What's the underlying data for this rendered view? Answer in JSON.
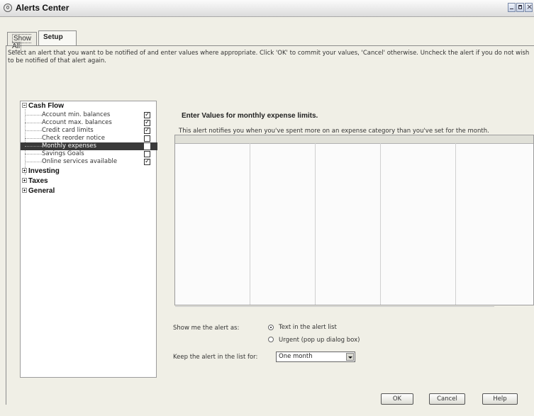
{
  "window": {
    "title": "Alerts Center"
  },
  "tabs": [
    {
      "label": "Show All"
    },
    {
      "label": "Setup"
    }
  ],
  "instructions": "Select an alert that you want to be notified of and enter values where appropriate. Click 'OK' to commit your values, 'Cancel' otherwise. Uncheck the alert if you do not wish to be notified of that alert again.",
  "tree": {
    "groups": [
      {
        "label": "Cash Flow",
        "expanded": true
      },
      {
        "label": "Investing",
        "expanded": false
      },
      {
        "label": "Taxes",
        "expanded": false
      },
      {
        "label": "General",
        "expanded": false
      }
    ],
    "cash_flow_items": [
      {
        "label": "Account min. balances",
        "checked": true
      },
      {
        "label": "Account max. balances",
        "checked": true
      },
      {
        "label": "Credit card limits",
        "checked": true
      },
      {
        "label": "Check reorder notice",
        "checked": false
      },
      {
        "label": "Monthly expenses",
        "checked": false,
        "selected": true
      },
      {
        "label": "Savings Goals",
        "checked": false
      },
      {
        "label": "Online services available",
        "checked": true
      }
    ]
  },
  "detail": {
    "heading": "Enter Values for monthly expense limits.",
    "description": "This alert notifies you when you've spent more on an expense category than you've set for the month.",
    "show_as_label": "Show me the alert as:",
    "options": [
      {
        "label": "Text in the alert list",
        "selected": true
      },
      {
        "label": "Urgent (pop up dialog box)",
        "selected": false
      }
    ],
    "keep_label": "Keep the alert in the list for:",
    "keep_value": "One month"
  },
  "buttons": {
    "ok": "OK",
    "cancel": "Cancel",
    "help": "Help"
  }
}
